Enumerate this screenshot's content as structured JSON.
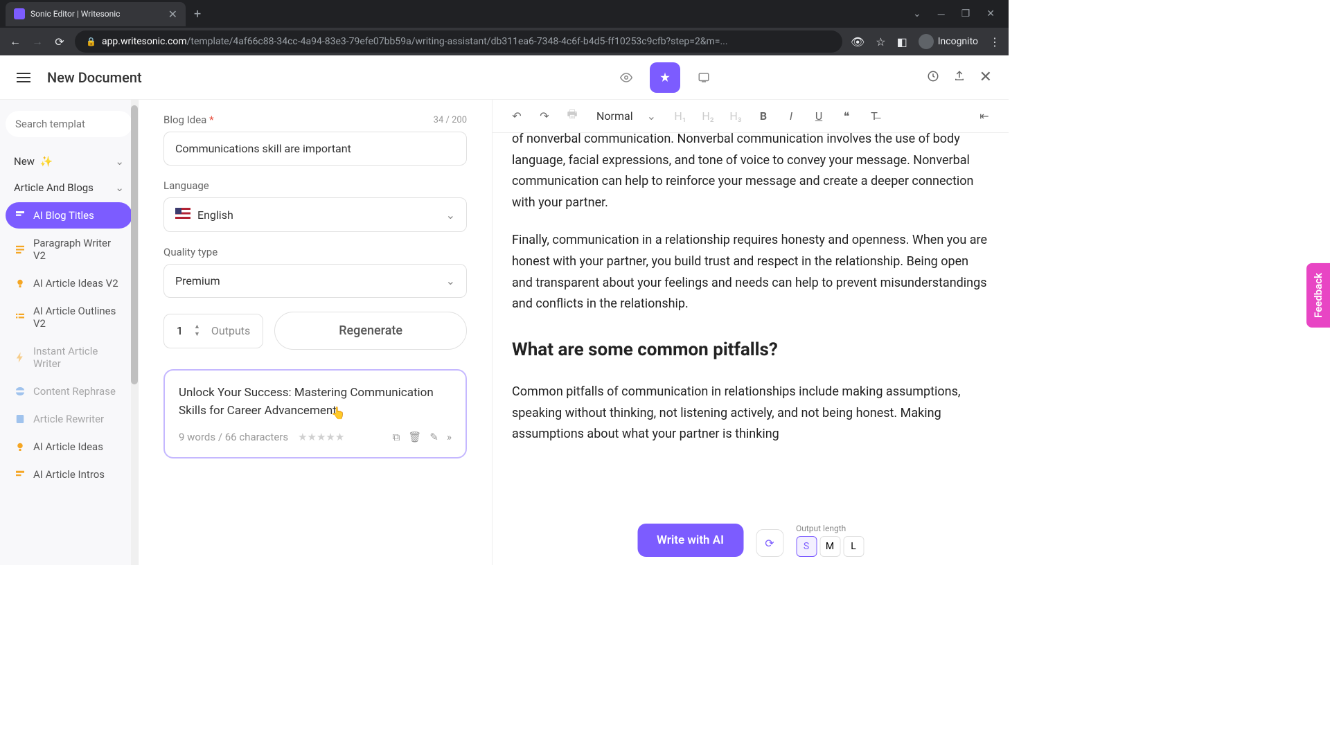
{
  "browser": {
    "tab_title": "Sonic Editor | Writesonic",
    "url_host": "app.writesonic.com",
    "url_path": "/template/4af66c88-34cc-4a94-83e3-79efe07bb59a/writing-assistant/db311ea6-7348-4c6f-b4d5-ff10253c9cfb?step=2&m=...",
    "incognito_label": "Incognito"
  },
  "header": {
    "doc_title": "New Document"
  },
  "sidebar": {
    "search_placeholder": "Search templat",
    "sections": {
      "new": "New",
      "article": "Article And Blogs"
    },
    "items": [
      "AI Blog Titles",
      "Paragraph Writer V2",
      "AI Article Ideas V2",
      "AI Article Outlines V2",
      "Instant Article Writer",
      "Content Rephrase",
      "Article Rewriter",
      "AI Article Ideas",
      "AI Article Intros"
    ]
  },
  "form": {
    "blog_idea_label": "Blog Idea",
    "blog_idea_count": "34 / 200",
    "blog_idea_value": "Communications skill are important",
    "language_label": "Language",
    "language_value": "English",
    "quality_label": "Quality type",
    "quality_value": "Premium",
    "outputs_value": "1",
    "outputs_label": "Outputs",
    "regenerate_label": "Regenerate",
    "result_title": "Unlock Your Success: Mastering Communication Skills for Career Advancement",
    "result_meta": "9 words / 66 characters"
  },
  "editor": {
    "toolbar": {
      "style": "Normal",
      "h1": "H₁",
      "h2": "H₂",
      "h3": "H₃",
      "bold": "B",
      "italic": "I",
      "underline": "U"
    },
    "para1": "of nonverbal communication. Nonverbal communication involves the use of body language, facial expressions, and tone of voice to convey your message. Nonverbal communication can help to reinforce your message and create a deeper connection with your partner.",
    "para2": "Finally, communication in a relationship requires honesty and openness. When you are honest with your partner, you build trust and respect in the relationship. Being open and transparent about your feelings and needs can help to prevent misunderstandings and conflicts in the relationship.",
    "heading": "What are some common pitfalls?",
    "para3": "Common pitfalls of communication in relationships include making assumptions, speaking without thinking, not listening actively, and not being honest. Making assumptions about what your partner is thinking",
    "write_ai": "Write with AI",
    "output_length_label": "Output length",
    "length_opts": [
      "S",
      "M",
      "L"
    ]
  },
  "feedback": "Feedback"
}
